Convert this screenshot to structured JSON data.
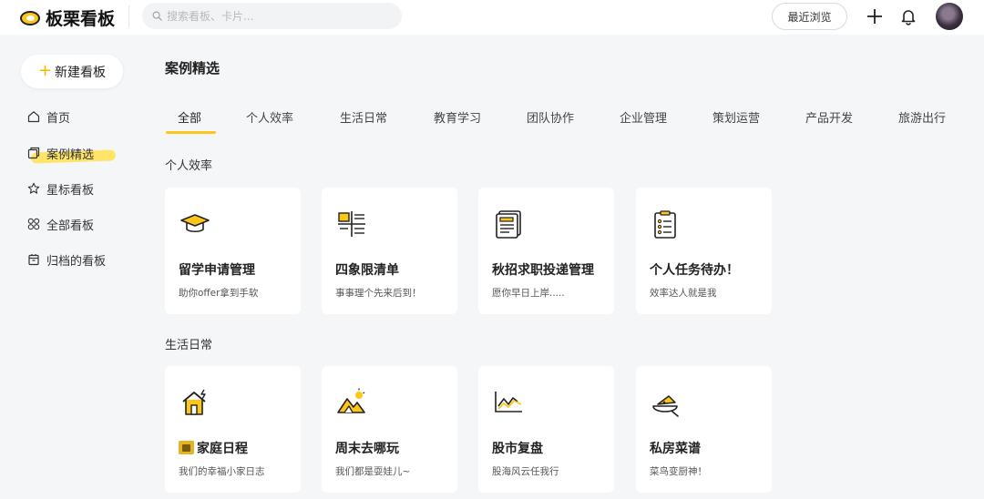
{
  "app": {
    "name": "板栗看板"
  },
  "search": {
    "placeholder": "搜索看板、卡片..."
  },
  "header": {
    "recent_label": "最近浏览",
    "icons": [
      "plus-icon",
      "bell-icon"
    ]
  },
  "sidebar": {
    "new_board_label": "新建看板",
    "items": [
      {
        "label": "首页",
        "icon": "home-icon"
      },
      {
        "label": "案例精选",
        "icon": "board-stack-icon",
        "active": true
      },
      {
        "label": "星标看板",
        "icon": "star-icon"
      },
      {
        "label": "全部看板",
        "icon": "grid-icon"
      },
      {
        "label": "归档的看板",
        "icon": "archive-icon"
      }
    ]
  },
  "main": {
    "title": "案例精选",
    "tabs": [
      {
        "label": "全部",
        "active": true
      },
      {
        "label": "个人效率"
      },
      {
        "label": "生活日常"
      },
      {
        "label": "教育学习"
      },
      {
        "label": "团队协作"
      },
      {
        "label": "企业管理"
      },
      {
        "label": "策划运营"
      },
      {
        "label": "产品开发"
      },
      {
        "label": "旅游出行"
      }
    ],
    "sections": [
      {
        "title": "个人效率",
        "cards": [
          {
            "title": "留学申请管理",
            "desc": "助你offer拿到手软",
            "icon": "graduation-cap-icon"
          },
          {
            "title": "四象限清单",
            "desc": "事事理个先来后到！",
            "icon": "quadrant-list-icon"
          },
          {
            "title": "秋招求职投递管理",
            "desc": "愿你早日上岸.....",
            "icon": "resume-icon"
          },
          {
            "title": "个人任务待办！",
            "desc": "效率达人就是我",
            "icon": "clipboard-checklist-icon"
          }
        ]
      },
      {
        "title": "生活日常",
        "cards": [
          {
            "title": "家庭日程",
            "desc": "我们的幸福小家日志",
            "icon": "house-icon",
            "title_emoji": "house-emoji"
          },
          {
            "title": "周末去哪玩",
            "desc": "我们都是耍娃儿~",
            "icon": "mountain-sun-icon"
          },
          {
            "title": "股市复盘",
            "desc": "股海风云任我行",
            "icon": "stock-chart-icon"
          },
          {
            "title": "私房菜谱",
            "desc": "菜鸟变厨神！",
            "icon": "dish-icon"
          }
        ]
      }
    ]
  },
  "colors": {
    "accent": "#ffc61a",
    "background": "#f5f6f8",
    "card": "#ffffff"
  }
}
